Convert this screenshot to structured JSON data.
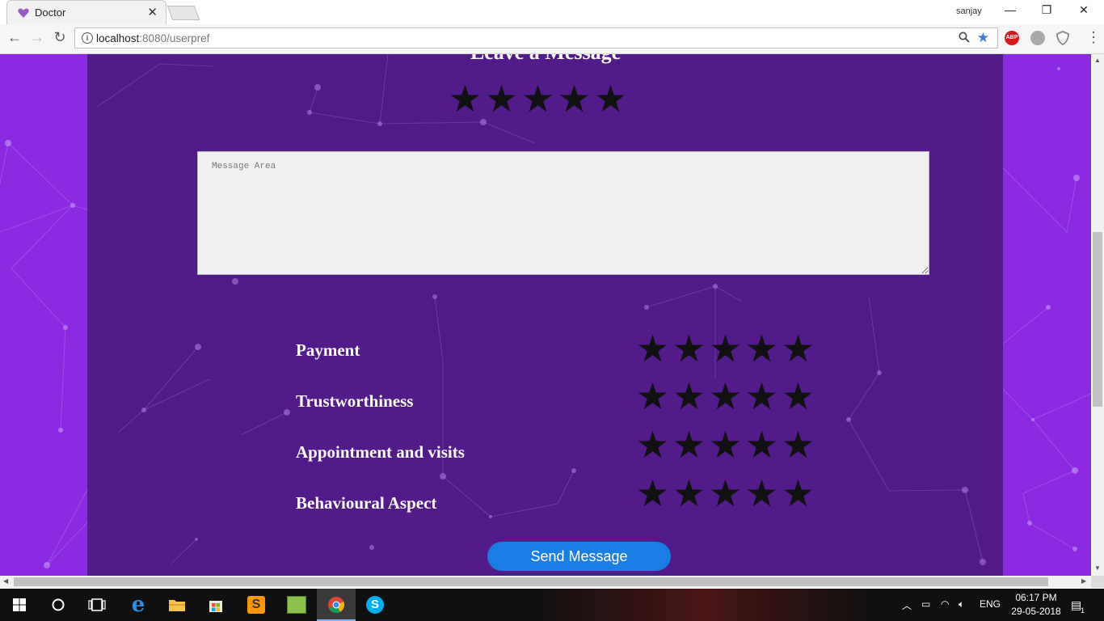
{
  "browser": {
    "tab_title": "Doctor",
    "tab_close": "✕",
    "profile_name": "sanjay",
    "window_controls": {
      "minimize": "—",
      "restore": "❐",
      "close": "✕"
    },
    "url_host": "localhost",
    "url_port_path": ":8080/userpref",
    "extensions": [
      {
        "name": "adblock-plus-icon",
        "label": "ABP",
        "color": "#d7191f"
      },
      {
        "name": "cloud-extension-icon",
        "label": "",
        "color": "#9a9a9a"
      },
      {
        "name": "shield-extension-icon",
        "label": "",
        "color": "#8c8c8c"
      }
    ]
  },
  "page": {
    "heading": "Leave a Message",
    "overall_rating": {
      "stars": 5,
      "filled": 0
    },
    "message_placeholder": "Message Area",
    "categories": [
      {
        "label": "Payment",
        "stars": 5
      },
      {
        "label": "Trustworthiness",
        "stars": 5
      },
      {
        "label": "Appointment and visits",
        "stars": 5
      },
      {
        "label": "Behavioural Aspect",
        "stars": 5
      }
    ],
    "send_label": "Send Message",
    "colors": {
      "page_bg": "#8a2be2",
      "panel_bg": "#531b8a",
      "star": "#111111",
      "button": "#1a7fe5"
    }
  },
  "taskbar": {
    "apps": [
      "start",
      "cortana",
      "task-view",
      "edge",
      "file-explorer",
      "store",
      "sublime-text",
      "terminal",
      "chrome",
      "skype"
    ],
    "language": "ENG",
    "time": "06:17 PM",
    "date": "29-05-2018",
    "notifications_count": "1"
  }
}
